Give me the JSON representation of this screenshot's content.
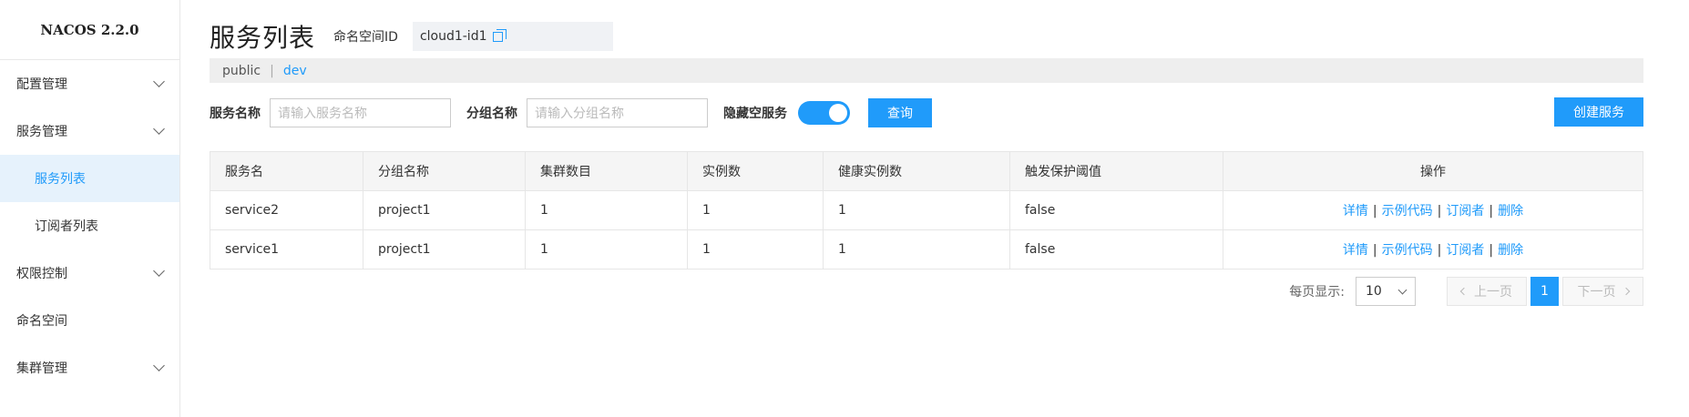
{
  "brand": "NACOS 2.2.0",
  "sidebar": {
    "items": [
      {
        "label": "配置管理"
      },
      {
        "label": "服务管理"
      },
      {
        "label": "服务列表"
      },
      {
        "label": "订阅者列表"
      },
      {
        "label": "权限控制"
      },
      {
        "label": "命名空间"
      },
      {
        "label": "集群管理"
      }
    ]
  },
  "header": {
    "title": "服务列表",
    "namespace_label": "命名空间ID",
    "namespace_value": "cloud1-id1"
  },
  "namespaces": [
    "public",
    "dev"
  ],
  "namespace_separator": "|",
  "filters": {
    "service_label": "服务名称",
    "service_placeholder": "请输入服务名称",
    "group_label": "分组名称",
    "group_placeholder": "请输入分组名称",
    "hide_empty_label": "隐藏空服务",
    "hide_empty_on": true,
    "query_button": "查询",
    "create_button": "创建服务"
  },
  "table": {
    "columns": [
      "服务名",
      "分组名称",
      "集群数目",
      "实例数",
      "健康实例数",
      "触发保护阈值",
      "操作"
    ],
    "rows": [
      [
        "service2",
        "project1",
        "1",
        "1",
        "1",
        "false"
      ],
      [
        "service1",
        "project1",
        "1",
        "1",
        "1",
        "false"
      ]
    ],
    "actions": [
      "详情",
      "示例代码",
      "订阅者",
      "删除"
    ],
    "action_separator": "|"
  },
  "pagination": {
    "page_size_label": "每页显示:",
    "page_size": "10",
    "prev": "上一页",
    "next": "下一页",
    "current": "1"
  },
  "colors": {
    "accent": "#209bfa",
    "active_bg": "#e6f2fc"
  }
}
